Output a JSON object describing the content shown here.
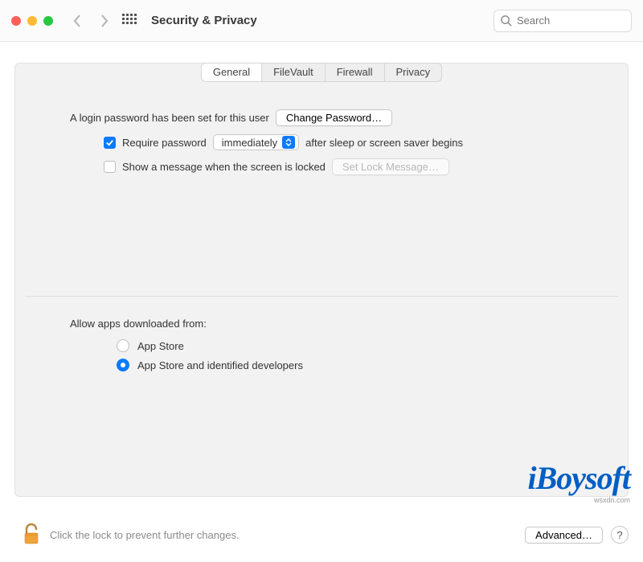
{
  "header": {
    "title": "Security & Privacy",
    "search_placeholder": "Search"
  },
  "tabs": [
    {
      "label": "General",
      "active": true
    },
    {
      "label": "FileVault",
      "active": false
    },
    {
      "label": "Firewall",
      "active": false
    },
    {
      "label": "Privacy",
      "active": false
    }
  ],
  "general": {
    "login_pwd_text": "A login password has been set for this user",
    "change_password_btn": "Change Password…",
    "require_pwd_label": "Require password",
    "require_pwd_delay_value": "immediately",
    "require_pwd_tail": "after sleep or screen saver begins",
    "require_pwd_checked": true,
    "show_message_label": "Show a message when the screen is locked",
    "show_message_checked": false,
    "set_lock_message_btn": "Set Lock Message…",
    "allow_apps_label": "Allow apps downloaded from:",
    "radio_options": [
      {
        "label": "App Store",
        "checked": false
      },
      {
        "label": "App Store and identified developers",
        "checked": true
      }
    ]
  },
  "footer": {
    "lock_text": "Click the lock to prevent further changes.",
    "advanced_btn": "Advanced…",
    "help": "?"
  },
  "watermark": {
    "brand": "iBoysoft",
    "attribution": "wsxdn.com"
  }
}
